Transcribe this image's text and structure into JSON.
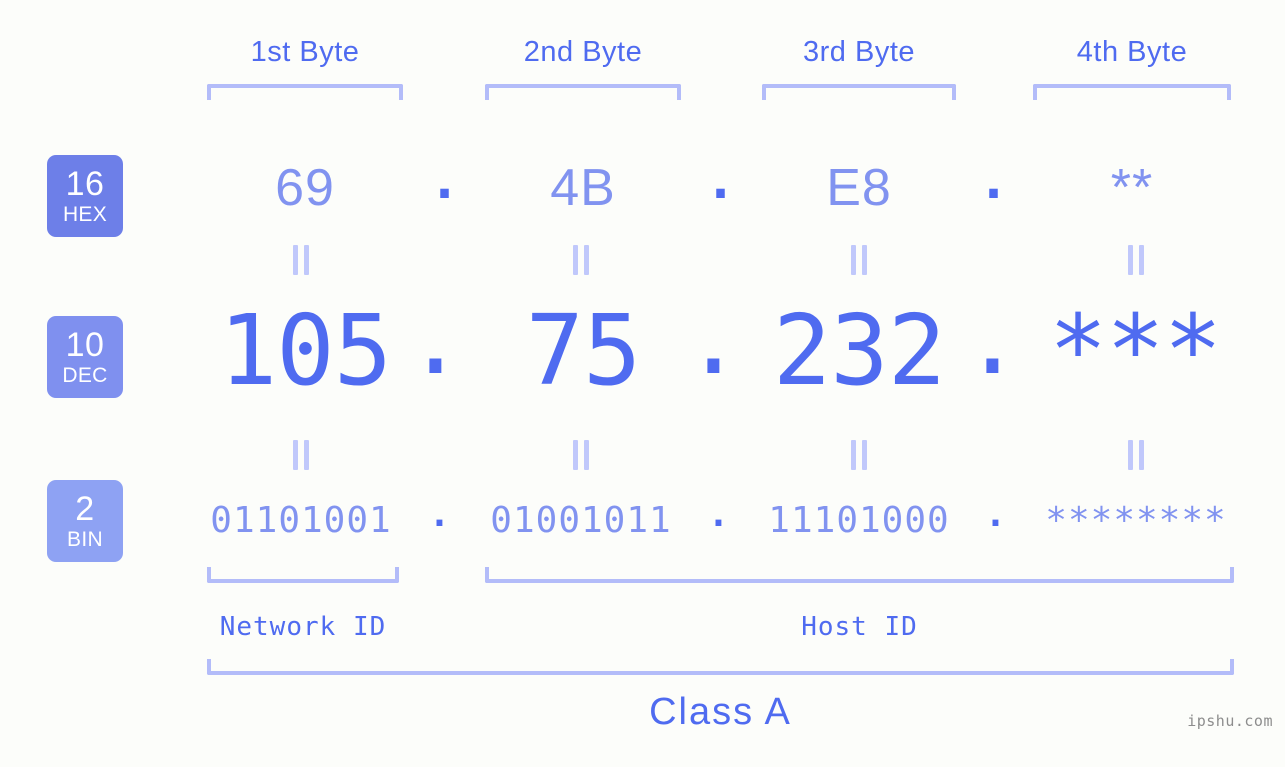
{
  "background_color": "#fcfdfa",
  "accent_color": "#4f6bf0",
  "muted_accent_color": "#8193f0",
  "bracket_color": "#b3bcf9",
  "byte_headers": [
    {
      "label": "1st Byte"
    },
    {
      "label": "2nd Byte"
    },
    {
      "label": "3rd Byte"
    },
    {
      "label": "4th Byte"
    }
  ],
  "rows": [
    {
      "badge_number": "16",
      "badge_name": "HEX",
      "badge_color": "#6d7fe8",
      "values": [
        "69",
        "4B",
        "E8",
        "**"
      ],
      "separator": "."
    },
    {
      "badge_number": "10",
      "badge_name": "DEC",
      "badge_color": "#7f90ef",
      "values": [
        "105",
        "75",
        "232",
        "***"
      ],
      "separator": "."
    },
    {
      "badge_number": "2",
      "badge_name": "BIN",
      "badge_color": "#8ea2f3",
      "values": [
        "01101001",
        "01001011",
        "11101000",
        "********"
      ],
      "separator": "."
    }
  ],
  "equality_marker": "=",
  "id_labels": {
    "network": "Network ID",
    "host": "Host ID"
  },
  "class_label": "Class A",
  "watermark": "ipshu.com"
}
